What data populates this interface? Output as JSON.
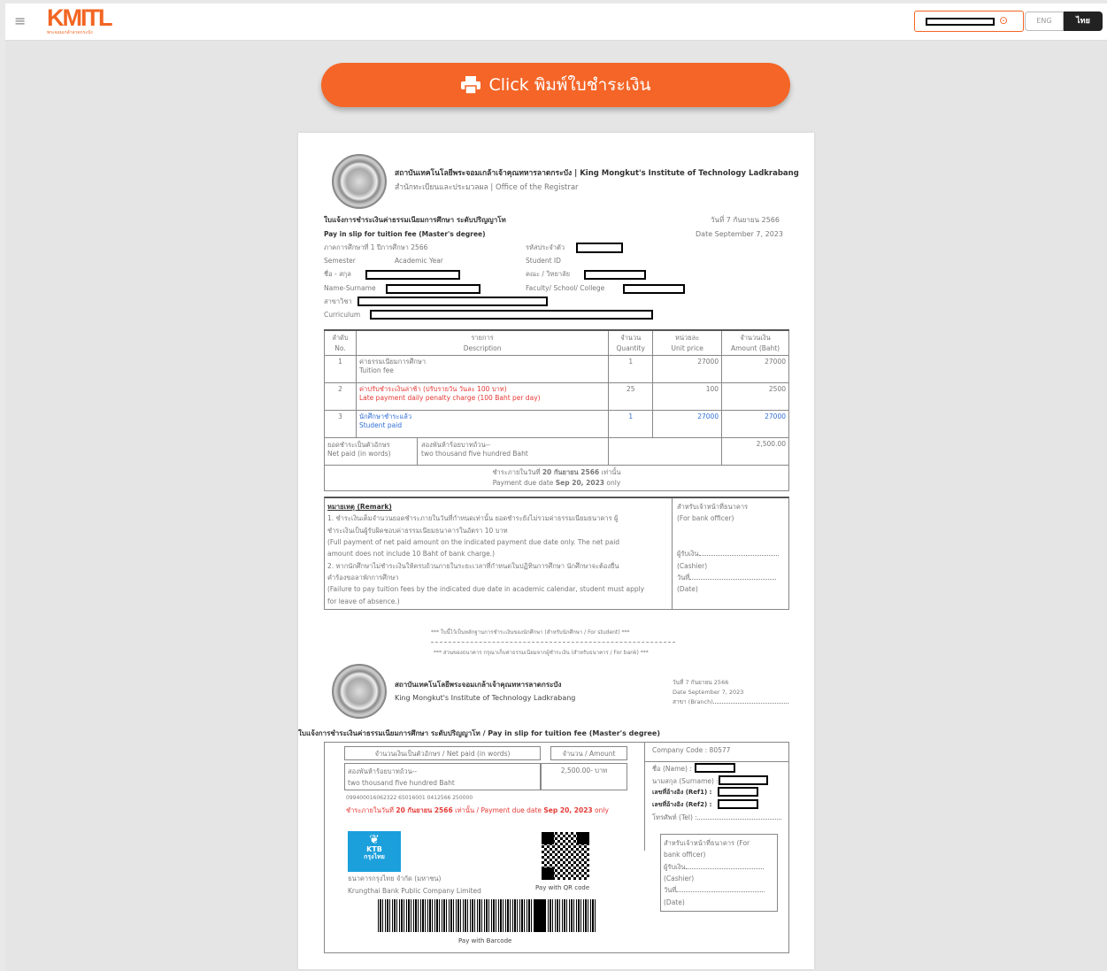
{
  "topbar": {
    "logo": "KMITL",
    "logo_sub": "พระจอมเกล้าลาดกระบัง",
    "lang_eng": "ENG",
    "lang_thai": "ไทย"
  },
  "print_button": {
    "label": "Click พิมพ์ใบชำระเงิน"
  },
  "slip": {
    "inst_th": "สถาบันเทคโนโลยีพระจอมเกล้าเจ้าคุณทหารลาดกระบัง | King Mongkut's Institute of Technology Ladkrabang",
    "office": "สำนักทะเบียนและประมวลผล | Office of the Registrar",
    "title_th": "ใบแจ้งการชำระเงินค่าธรรมเนียมการศึกษา ระดับปริญญาโท",
    "title_en": "Pay in slip for tuition fee  (Master's degree)",
    "date_th": "วันที่ 7 กันยายน 2566",
    "date_en": "Date  September 7, 2023",
    "semester_th": "ภาคการศึกษาที่  1    ปีการศึกษา    2566",
    "semester_en": "Semester",
    "academic_year_en": "Academic Year",
    "student_id_th": "รหัสประจำตัว",
    "student_id_en": "Student ID",
    "name_th": "ชื่อ - สกุล",
    "name_en": "Name-Surname",
    "faculty_th": "คณะ / วิทยาลัย",
    "faculty_en": "Faculty/ School/ College",
    "major_th": "สาขาวิชา",
    "curriculum_en": "Curriculum",
    "table_headers": [
      {
        "th": "ลำดับ",
        "en": "No."
      },
      {
        "th": "รายการ",
        "en": "Description"
      },
      {
        "th": "จำนวน",
        "en": "Quantity"
      },
      {
        "th": "หน่วยละ",
        "en": "Unit price"
      },
      {
        "th": "จำนวนเงิน",
        "en": "Amount (Baht)"
      }
    ],
    "rows": [
      {
        "no": "1",
        "desc_th": "ค่าธรรมเนียมการศึกษา",
        "desc_en": "Tuition fee",
        "qty": "1",
        "unit": "27000",
        "amount": "27000"
      },
      {
        "no": "2",
        "desc_th": "ค่าปรับชำระเงินล่าช้า (ปรับรายวัน วันละ 100 บาท)",
        "desc_en": "Late payment daily penalty charge (100 Baht per day)",
        "qty": "25",
        "unit": "100",
        "amount": "2500"
      },
      {
        "no": "3",
        "desc_th": "นักศึกษาชำระแล้ว",
        "desc_en": "Student paid",
        "qty": "1",
        "unit": "27000",
        "amount": "27000"
      }
    ],
    "net_words_th": "ยอดชำระเป็นตัวอักษร",
    "net_words_en": "Net paid (in words)",
    "net_words_value_th": "สองพันห้าร้อยบาทถ้วน--",
    "net_words_value_en": "two thousand five hundred Baht",
    "net_amount": "2,500.00",
    "due_th_pre": "ชำระภายในวันที่ ",
    "due_th_date": "20 กันยายน 2566",
    "due_th_post": " เท่านั้น",
    "due_en_pre": "Payment due date ",
    "due_en_date": "Sep 20, 2023",
    "due_en_post": " only",
    "remark_title": "หมายเหตุ (Remark)",
    "remark_lines": [
      "1. ชำระเงินเต็มจำนวนยอดชำระภายในวันที่กำหนดเท่านั้น ยอดชำระยังไม่รวมค่าธรรมเนียมธนาคาร ผู้",
      "ชำระเงินเป็นผู้รับผิดชอบค่าธรรมเนียมธนาคารในอัตรา 10 บาท",
      "(Full payment of net paid amount on the indicated payment due date only. The net paid",
      "amount does not include 10 Baht of bank charge.)",
      "2. หากนักศึกษาไม่ชำระเงินให้ครบถ้วนภายในระยะเวลาที่กำหนดในปฏิทินการศึกษา นักศึกษาจะต้องยื่น",
      "คำร้องขอลาพักการศึกษา",
      "(Failure to pay tuition fees by the indicated due date in academic calendar, student must apply",
      "for leave of absence.)"
    ],
    "bank_officer_th": "สำหรับเจ้าหน้าที่ธนาคาร",
    "bank_officer_en": "(For bank officer)",
    "receiver_th": "ผู้รับเงิน",
    "cashier_en": "(Cashier)",
    "day_th": "วันที่",
    "date_label_en": "(Date)",
    "student_copy": "*** ใบนี้ไว้เป็นหลักฐานการชำระเงินของนักศึกษา (สำหรับนักศึกษา / For student) ***",
    "bank_copy": "*** ส่วนของธนาคาร กรุณาเก็บค่าธรรมเนียมจากผู้ชำระเงิน (สำหรับธนาคาร / For bank) ***"
  },
  "bank_part": {
    "inst_th": "สถาบันเทคโนโลยีพระจอมเกล้าเจ้าคุณทหารลาดกระบัง",
    "inst_en": "King Mongkut's Institute of Technology Ladkrabang",
    "date_th": "วันที่  7 กันยายน 2566",
    "date_en": "Date  September 7, 2023",
    "branch": "สาขา (Branch)",
    "title": "ใบแจ้งการชำระเงินค่าธรรมเนียมการศึกษา ระดับปริญญาโท / Pay in slip for tuition fee  (Master's degree)",
    "net_words_header": "จำนวนเงินเป็นตัวอักษร / Net paid (in words)",
    "amount_header": "จำนวน / Amount",
    "words_th": "สองพันห้าร้อยบาทถ้วน--",
    "words_en": "two thousand five hundred Baht",
    "amount_value": "2,500.00- บาท",
    "ref_code": "099400016062322 65016001 0412566 250000",
    "due_th_pre": "ชำระภายในวันที่ ",
    "due_th_date": "20 กันยายน 2566",
    "due_th_post": " เท่านั้น / Payment due date ",
    "due_en_date": "Sep 20, 2023",
    "due_en_post": " only",
    "company_code": "Company Code : 80577",
    "name_label": "ชื่อ (Name) :",
    "surname_label": "นามสกุล (Surname) :",
    "ref1_label": "เลขที่อ้างอิง (Ref1) :",
    "ref2_label": "เลขที่อ้างอิง (Ref2) :",
    "tel_label": "โทรศัพท์ (Tel) :",
    "bank_officer": "สำหรับเจ้าหน้าที่ธนาคาร (For",
    "bank_officer2": "bank officer)",
    "receiver": "ผู้รับเงิน",
    "cashier": "(Cashier)",
    "day": "วันที่",
    "date_label": "(Date)",
    "ktb_logo": "KTB",
    "ktb_logo_th": "กรุงไทย",
    "bank_name_th": "ธนาคารกรุงไทย จำกัด (มหาชน)",
    "bank_name_en": "Krungthai Bank Public Company Limited",
    "qr_label": "Pay with QR code",
    "barcode_label": "Pay with Barcode"
  }
}
